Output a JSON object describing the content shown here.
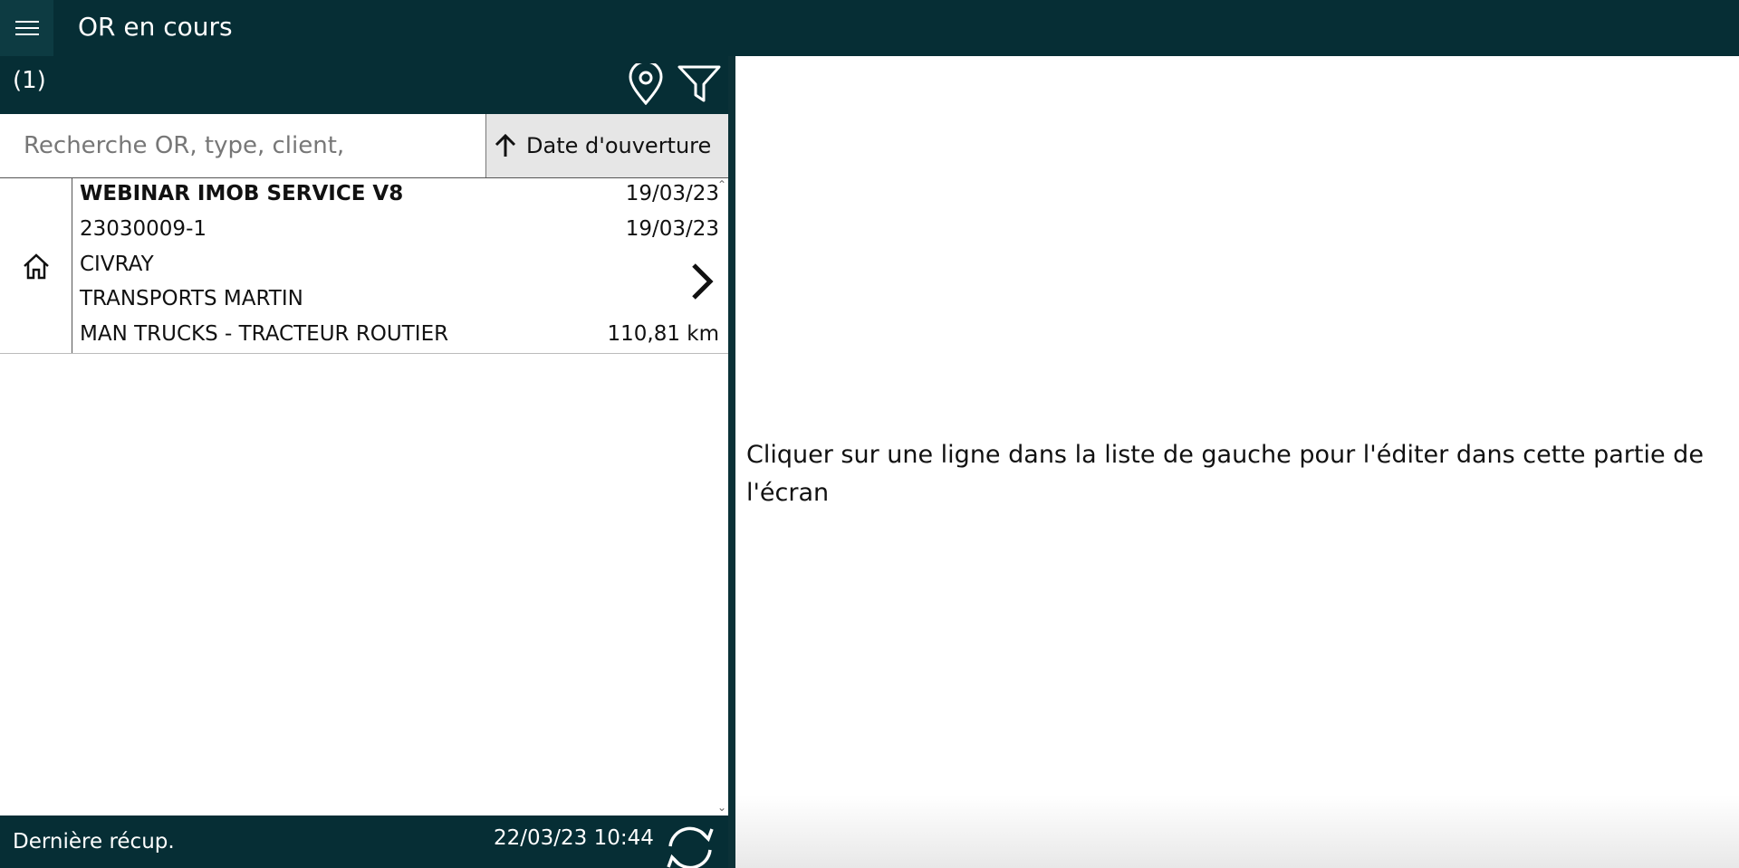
{
  "header": {
    "title": "OR en cours",
    "menu_icon": "hamburger-icon"
  },
  "toolbar": {
    "count": "(1)",
    "location_icon": "map-pin-icon",
    "filter_icon": "filter-icon"
  },
  "search": {
    "placeholder": "Recherche OR, type, client,",
    "value": ""
  },
  "sort": {
    "label": "Date d'ouverture",
    "direction_icon": "arrow-up-icon"
  },
  "list": {
    "items": [
      {
        "icon": "home-icon",
        "title": "WEBINAR IMOB SERVICE V8",
        "date1": "19/03/23",
        "number": "23030009-1",
        "date2": "19/03/23",
        "site": "CIVRAY",
        "client": "TRANSPORTS MARTIN",
        "vehicle": "MAN TRUCKS - TRACTEUR ROUTIER",
        "distance": "110,81 km"
      }
    ]
  },
  "footer": {
    "label": "Dernière récup.",
    "timestamp": "22/03/23 10:44",
    "refresh_icon": "refresh-icon"
  },
  "detail": {
    "hint": "Cliquer sur une ligne dans la liste de gauche pour l'éditer dans cette partie de l'écran"
  },
  "colors": {
    "primary": "#062e35",
    "sort_bg": "#e6e6e6"
  }
}
